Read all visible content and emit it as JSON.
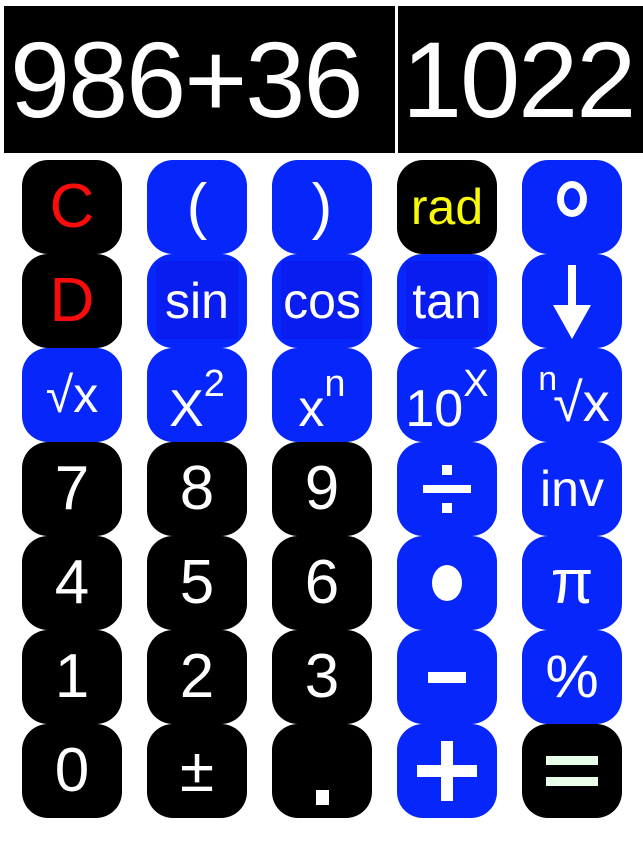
{
  "app": {
    "name": "scientific-calculator",
    "colors": {
      "blue": "#0626FB",
      "black": "#000000",
      "white": "#FFFFFF",
      "red": "#FB0C0C",
      "yellow": "#F9F90A",
      "equals_green": "#E8FFE8"
    }
  },
  "display": {
    "expression": "986+36",
    "result": "1022"
  },
  "keypad": {
    "rows": [
      {
        "keys": [
          {
            "label": "C",
            "icon": "clear-icon",
            "style": "dark",
            "text_color": "#FB0C0C"
          },
          {
            "label": "(",
            "icon": "open-paren-icon",
            "style": "blue",
            "text_color": "#FFFFFF"
          },
          {
            "label": ")",
            "icon": "close-paren-icon",
            "style": "blue",
            "text_color": "#FFFFFF"
          },
          {
            "label": "rad",
            "icon": "radians-mode-icon",
            "style": "dark",
            "text_color": "#F9F90A"
          },
          {
            "label": "°",
            "icon": "degree-icon",
            "style": "blue",
            "text_color": "#FFFFFF"
          }
        ]
      },
      {
        "keys": [
          {
            "label": "D",
            "icon": "delete-icon",
            "style": "dark",
            "text_color": "#FB0C0C"
          },
          {
            "label": "sin",
            "icon": "sine-icon",
            "style": "blue",
            "text_color": "#FFFFFF"
          },
          {
            "label": "cos",
            "icon": "cosine-icon",
            "style": "blue",
            "text_color": "#FFFFFF"
          },
          {
            "label": "tan",
            "icon": "tangent-icon",
            "style": "blue",
            "text_color": "#FFFFFF"
          },
          {
            "label": "↓",
            "icon": "down-arrow-icon",
            "style": "blue",
            "text_color": "#FFFFFF"
          }
        ]
      },
      {
        "keys": [
          {
            "label": "√x",
            "icon": "square-root-icon",
            "style": "blue",
            "text_color": "#FFFFFF"
          },
          {
            "label": "x²",
            "icon": "x-squared-icon",
            "style": "blue",
            "text_color": "#FFFFFF"
          },
          {
            "label": "xⁿ",
            "icon": "x-power-n-icon",
            "style": "blue",
            "text_color": "#FFFFFF"
          },
          {
            "label": "10ˣ",
            "icon": "ten-power-x-icon",
            "style": "blue",
            "text_color": "#FFFFFF"
          },
          {
            "label": "ⁿ√x",
            "icon": "nth-root-icon",
            "style": "blue",
            "text_color": "#FFFFFF"
          }
        ]
      },
      {
        "keys": [
          {
            "label": "7",
            "icon": "digit-7-icon",
            "style": "dark",
            "text_color": "#FFFFFF"
          },
          {
            "label": "8",
            "icon": "digit-8-icon",
            "style": "dark",
            "text_color": "#FFFFFF"
          },
          {
            "label": "9",
            "icon": "digit-9-icon",
            "style": "dark",
            "text_color": "#FFFFFF"
          },
          {
            "label": "÷",
            "icon": "divide-icon",
            "style": "blue",
            "text_color": "#FFFFFF"
          },
          {
            "label": "inv",
            "icon": "inverse-icon",
            "style": "blue",
            "text_color": "#FFFFFF"
          }
        ]
      },
      {
        "keys": [
          {
            "label": "4",
            "icon": "digit-4-icon",
            "style": "dark",
            "text_color": "#FFFFFF"
          },
          {
            "label": "5",
            "icon": "digit-5-icon",
            "style": "dark",
            "text_color": "#FFFFFF"
          },
          {
            "label": "6",
            "icon": "digit-6-icon",
            "style": "dark",
            "text_color": "#FFFFFF"
          },
          {
            "label": "•",
            "icon": "multiply-icon",
            "style": "blue",
            "text_color": "#FFFFFF"
          },
          {
            "label": "π",
            "icon": "pi-icon",
            "style": "blue",
            "text_color": "#FFFFFF"
          }
        ]
      },
      {
        "keys": [
          {
            "label": "1",
            "icon": "digit-1-icon",
            "style": "dark",
            "text_color": "#FFFFFF"
          },
          {
            "label": "2",
            "icon": "digit-2-icon",
            "style": "dark",
            "text_color": "#FFFFFF"
          },
          {
            "label": "3",
            "icon": "digit-3-icon",
            "style": "dark",
            "text_color": "#FFFFFF"
          },
          {
            "label": "-",
            "icon": "minus-icon",
            "style": "blue",
            "text_color": "#FFFFFF"
          },
          {
            "label": "%",
            "icon": "percent-icon",
            "style": "blue",
            "text_color": "#FFFFFF"
          }
        ]
      },
      {
        "keys": [
          {
            "label": "0",
            "icon": "digit-0-icon",
            "style": "dark",
            "text_color": "#FFFFFF"
          },
          {
            "label": "±",
            "icon": "plus-minus-icon",
            "style": "dark",
            "text_color": "#FFFFFF"
          },
          {
            "label": ".",
            "icon": "decimal-point-icon",
            "style": "dark",
            "text_color": "#FFFFFF"
          },
          {
            "label": "+",
            "icon": "plus-icon",
            "style": "blue",
            "text_color": "#FFFFFF"
          },
          {
            "label": "=",
            "icon": "equals-icon",
            "style": "dark",
            "text_color": "#E8FFE8"
          }
        ]
      }
    ],
    "composite_labels": {
      "sqrt_x": {
        "radical": "√x"
      },
      "x_squared": {
        "base": "X",
        "exp": "2"
      },
      "x_n": {
        "base": "x",
        "exp": "n"
      },
      "ten_x": {
        "base": "10",
        "exp": "X"
      },
      "nth_root": {
        "index": "n",
        "radical": "√x"
      }
    }
  }
}
